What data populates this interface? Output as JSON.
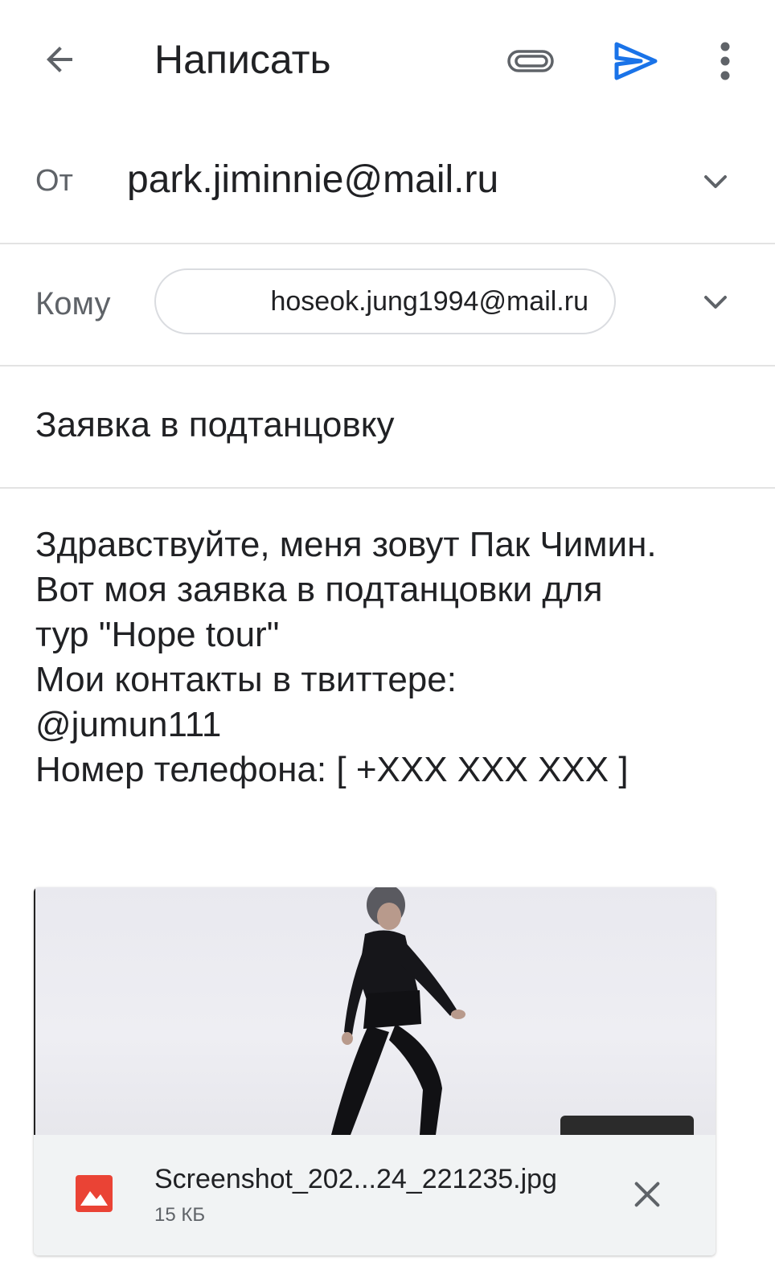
{
  "appbar": {
    "title": "Написать",
    "back_icon": "arrow-back-icon",
    "attach_icon": "paperclip-icon",
    "send_icon": "send-icon",
    "more_icon": "more-vert-icon",
    "send_color": "#1a73e8"
  },
  "from": {
    "label": "От",
    "value": "park.jiminnie@mail.ru"
  },
  "to": {
    "label": "Кому",
    "recipient": "hoseok.jung1994@mail.ru"
  },
  "subject": "Заявка в подтанцовку",
  "body": {
    "lines": [
      "Здравствуйте, меня зовут Пак Чимин.",
      "Вот моя заявка в подтанцовки для",
      "тур \"Hope tour\"",
      "Мои контакты в твиттере:",
      "@jumun111",
      "Номер телефона: [ +XXX XXX XXX ]"
    ]
  },
  "attachment": {
    "file_name": "Screenshot_202...24_221235.jpg",
    "file_size": "15 КБ",
    "icon": "image-file-icon",
    "icon_color": "#ea4335",
    "remove_icon": "close-icon"
  }
}
